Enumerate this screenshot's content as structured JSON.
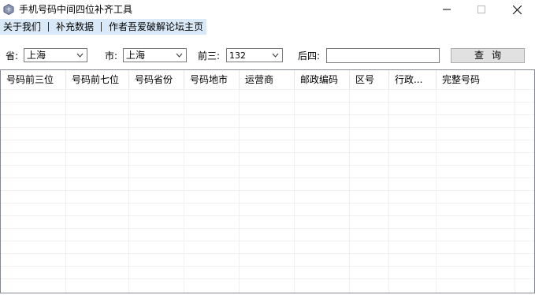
{
  "window": {
    "title": "手机号码中间四位补齐工具",
    "minimize_icon": "minimize-icon",
    "maximize_icon": "maximize-icon",
    "close_icon": "close-icon"
  },
  "menu": {
    "items": [
      {
        "label": "关于我们"
      },
      {
        "label": "补充数据"
      },
      {
        "label": "作者吾爱破解论坛主页"
      }
    ]
  },
  "filters": {
    "province_label": "省:",
    "province_value": "上海",
    "city_label": "市:",
    "city_value": "上海",
    "prefix_label": "前三:",
    "prefix_value": "132",
    "suffix_label": "后四:",
    "suffix_value": "",
    "query_button": "查询"
  },
  "table": {
    "columns": [
      {
        "label": "号码前三位"
      },
      {
        "label": "号码前七位"
      },
      {
        "label": "号码省份"
      },
      {
        "label": "号码地市"
      },
      {
        "label": "运营商"
      },
      {
        "label": "邮政编码"
      },
      {
        "label": "区号"
      },
      {
        "label": "行政..."
      },
      {
        "label": "完整号码"
      }
    ],
    "rows": []
  },
  "colors": {
    "menubar_bg": "#d9e9f7",
    "border": "#828790",
    "button_bg": "#e1e1e1"
  }
}
